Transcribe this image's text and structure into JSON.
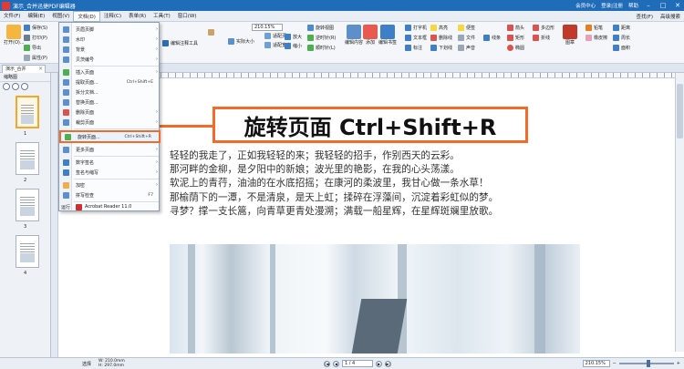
{
  "window": {
    "title": "演示_合并迅捷PDF编辑器",
    "user_center": "会员中心",
    "login": "登录|注册",
    "help": "帮助"
  },
  "menubar": {
    "items": [
      "文件(F)",
      "编辑(E)",
      "视图(V)",
      "文档(D)",
      "注释(C)",
      "表单(R)",
      "工具(T)",
      "窗口(W)"
    ],
    "active_index": 3,
    "right": {
      "find": "查找(F)",
      "advanced_find": "高级搜索"
    }
  },
  "ribbon": {
    "open": "打开(O)...",
    "save": "保存(S)",
    "print": "打印(P)",
    "export": "导出",
    "properties": "属性(P)",
    "edit_form_tool": "编辑表单工具",
    "edit_annotation_tool": "编辑注释工具",
    "zoom_value": "210.15%",
    "zoom_in": "放大",
    "zoom_out": "缩小",
    "actual_size": "实际大小",
    "fit_page": "适配页面",
    "fit_width": "适配宽度",
    "fit_visible": "适配可见",
    "rotate_view": "旋转视图",
    "rotate_left": "逆时针(R)",
    "rotate_right": "顺时针(L)",
    "edit_content": "编辑内容",
    "add": "添加",
    "edit_bookmark": "编辑书签",
    "typewriter": "打字机",
    "textbox": "文本框",
    "note": "标注",
    "highlight": "高亮",
    "strikeout": "删除线",
    "underline": "下划线",
    "sticky": "便签",
    "file": "文件",
    "sound": "声音",
    "line": "线条",
    "arrow": "箭头",
    "rect": "矩形",
    "oval": "椭圆",
    "polygon": "多边形",
    "polyline": "折线",
    "stamp": "图章",
    "pencil": "铅笔",
    "eraser": "橡皮擦",
    "distance": "距离",
    "perimeter": "周长",
    "area": "面积"
  },
  "doc_tab": {
    "label": "演示_合并"
  },
  "thumbnails": {
    "title": "缩略图",
    "pages": [
      "1",
      "2",
      "3",
      "4"
    ]
  },
  "doc_menu": {
    "items": [
      {
        "label": "页眉页脚",
        "shortcut": "",
        "arrow": "›"
      },
      {
        "label": "水印",
        "shortcut": "",
        "arrow": "›"
      },
      {
        "label": "背景",
        "shortcut": "",
        "arrow": "›"
      },
      {
        "label": "贝茨编号",
        "shortcut": "",
        "arrow": "›"
      },
      {
        "label": "插入页面",
        "shortcut": "",
        "arrow": "›"
      },
      {
        "label": "提取页面...",
        "shortcut": "Ctrl+Shift+E",
        "arrow": ""
      },
      {
        "label": "拆分文档...",
        "shortcut": "",
        "arrow": ""
      },
      {
        "label": "替换页面...",
        "shortcut": "",
        "arrow": ""
      },
      {
        "label": "删除页面",
        "shortcut": "",
        "arrow": "›"
      },
      {
        "label": "裁剪页面",
        "shortcut": "",
        "arrow": "›"
      },
      {
        "label": "旋转页面...",
        "shortcut": "Ctrl+Shift+R",
        "arrow": ""
      },
      {
        "label": "更多页面",
        "shortcut": "",
        "arrow": "›"
      },
      {
        "label": "数字签名",
        "shortcut": "",
        "arrow": "›"
      },
      {
        "label": "签名与缩写",
        "shortcut": "",
        "arrow": "›"
      },
      {
        "label": "加密",
        "shortcut": "",
        "arrow": "›"
      },
      {
        "label": "拼写检查",
        "shortcut": "F7",
        "arrow": ""
      },
      {
        "label": "Acrobat Reader 11.0",
        "prefix": "运行",
        "shortcut": "",
        "arrow": ""
      }
    ]
  },
  "overlay_title": "旋转页面 Ctrl+Shift+R",
  "document_text": [
    "轻轻的我走了，正如我轻轻的来；我轻轻的招手，作别西天的云彩。",
    "那河畔的金柳，是夕阳中的新娘；波光里的艳影，在我的心头荡漾。",
    "软泥上的青荇，油油的在水底招摇；在康河的柔波里，我甘心做一条水草！",
    "那榆荫下的一潭，不是清泉，是天上虹；揉碎在浮藻间，沉淀着彩虹似的梦。",
    "寻梦？撑一支长篙，向青草更青处漫溯；满载一船星辉，在星辉斑斓里放歌。"
  ],
  "statusbar": {
    "select": "选择",
    "width": "W: 210.0mm",
    "height": "H: 297.0mm",
    "page": "1 / 4",
    "zoom": "210.15%"
  },
  "colors": {
    "accent": "#f26b2a",
    "titlebar": "#1f6cb8"
  }
}
